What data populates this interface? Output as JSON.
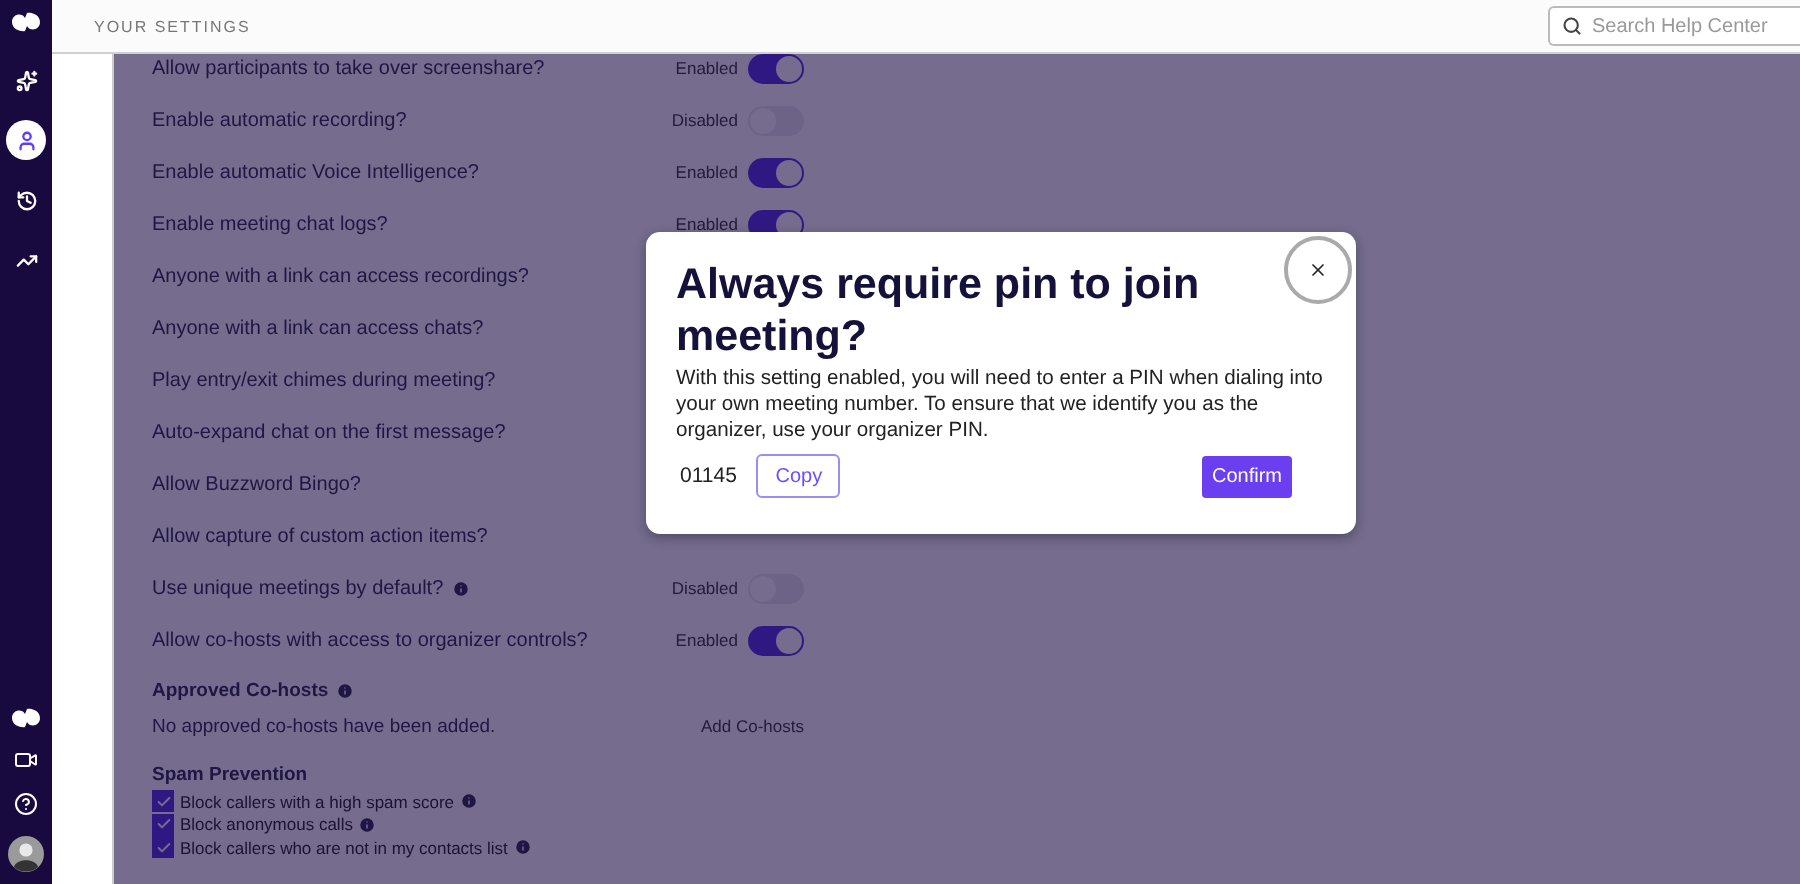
{
  "header": {
    "title": "YOUR SETTINGS",
    "search": {
      "placeholder": "Search Help Center"
    }
  },
  "sidebar": {
    "items": [
      {
        "selected": false
      },
      {
        "selected": true
      },
      {
        "selected": false
      },
      {
        "selected": false
      }
    ]
  },
  "settings": [
    {
      "label": "Allow participants to take over screenshare?",
      "status": "Enabled",
      "on": true
    },
    {
      "label": "Enable automatic recording?",
      "status": "Disabled",
      "on": false
    },
    {
      "label": "Enable automatic Voice Intelligence?",
      "status": "Enabled",
      "on": true
    },
    {
      "label": "Enable meeting chat logs?",
      "status": "Enabled",
      "on": true
    },
    {
      "label": "Anyone with a link can access recordings?"
    },
    {
      "label": "Anyone with a link can access chats?"
    },
    {
      "label": "Play entry/exit chimes during meeting?"
    },
    {
      "label": "Auto-expand chat on the first message?"
    },
    {
      "label": "Allow Buzzword Bingo?"
    },
    {
      "label": "Allow capture of custom action items?"
    },
    {
      "label": "Use unique meetings by default?",
      "info": true,
      "status": "Disabled",
      "on": false
    },
    {
      "label": "Allow co-hosts with access to organizer controls?",
      "status": "Enabled",
      "on": true
    }
  ],
  "cohosts": {
    "title": "Approved Co-hosts",
    "empty": "No approved co-hosts have been added.",
    "action": "Add Co-hosts"
  },
  "spam": {
    "title": "Spam Prevention",
    "options": [
      {
        "label": "Block callers with a high spam score",
        "checked": true
      },
      {
        "label": "Block anonymous calls",
        "checked": true
      },
      {
        "label": "Block callers who are not in my contacts list",
        "checked": true
      }
    ]
  },
  "modal": {
    "title": "Always require pin to join meeting?",
    "body": "With this setting enabled, you will need to enter a PIN when dialing into your own meeting number. To ensure that we identify you as the organizer, use your organizer PIN.",
    "pin": "01145",
    "copy": "Copy",
    "confirm": "Confirm"
  }
}
